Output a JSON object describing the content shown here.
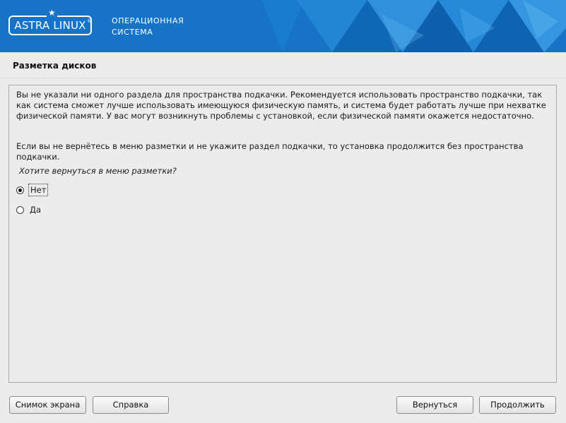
{
  "header": {
    "logo_text": "ASTRA LINUX",
    "brand_line1": "ОПЕРАЦИОННАЯ",
    "brand_line2": "СИСТЕМА"
  },
  "page_title": "Разметка дисков",
  "content": {
    "paragraph1": "Вы не указали ни одного раздела для пространства подкачки. Рекомендуется использовать пространство подкачки, так как система сможет лучше использовать имеющуюся физическую память, и система будет работать лучше при нехватке физической памяти. У вас могут возникнуть проблемы с установкой, если физической памяти окажется недостаточно.",
    "paragraph2": "Если вы не вернётесь в меню разметки и не укажите раздел подкачки, то установка продолжится без пространства подкачки.",
    "question": "Хотите вернуться в меню разметки?",
    "options": [
      {
        "label": "Нет",
        "selected": true
      },
      {
        "label": "Да",
        "selected": false
      }
    ]
  },
  "buttons": {
    "screenshot": "Снимок экрана",
    "help": "Справка",
    "back": "Вернуться",
    "continue": "Продолжить"
  },
  "colors": {
    "banner": "#1673c6",
    "background": "#ececec"
  }
}
